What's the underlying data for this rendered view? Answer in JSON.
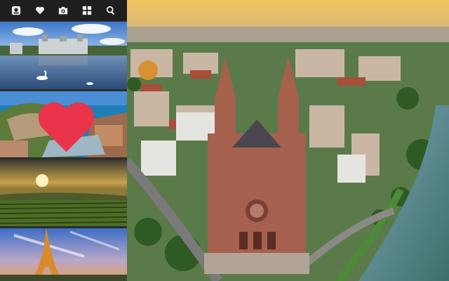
{
  "toolbar": {
    "buttons": [
      {
        "name": "photo-icon",
        "interactable": true
      },
      {
        "name": "heart-icon",
        "interactable": true
      },
      {
        "name": "camera-icon",
        "interactable": true
      },
      {
        "name": "grid-icon",
        "interactable": true
      },
      {
        "name": "search-icon",
        "interactable": true
      }
    ]
  },
  "thumbnails": [
    {
      "scene": "chateau-lake-with-swans"
    },
    {
      "scene": "coastal-harbor-town",
      "favorited": true
    },
    {
      "scene": "vineyard-sunset"
    },
    {
      "scene": "eiffel-tower-dusk"
    }
  ],
  "main_image": {
    "scene": "cathedral-city-aerial-sunrise"
  },
  "colors": {
    "toolbar_bg": "#1f1f1f",
    "icon": "#f2f2f2",
    "favorite": "#e8334a"
  }
}
